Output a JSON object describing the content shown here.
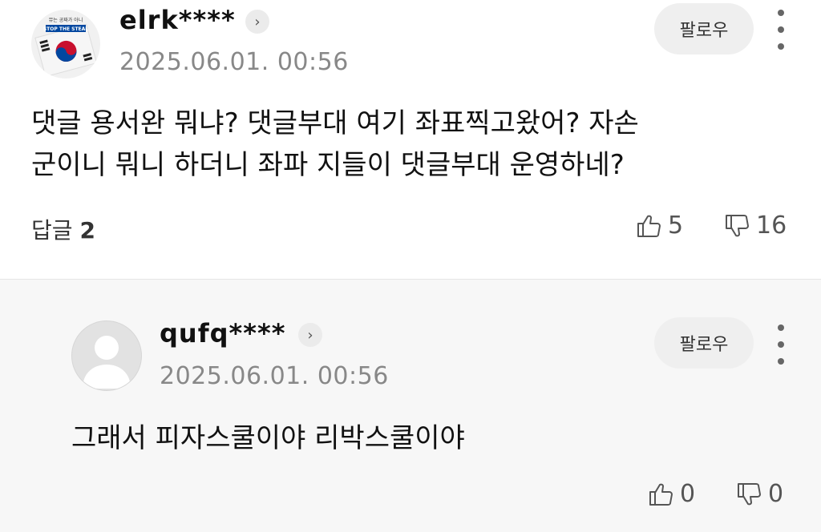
{
  "comments": [
    {
      "username": "elrk****",
      "timestamp": "2025.06.01. 00:56",
      "follow_label": "팔로우",
      "text_lines": [
        "댓글 용서완 뭐냐? 댓글부대 여기 좌표찍고왔어? 자손",
        "군이니 뭐니 하더니 좌파 지들이 댓글부대 운영하네?"
      ],
      "reply_label": "답글",
      "reply_count": "2",
      "likes": "5",
      "dislikes": "16",
      "avatar_text_top": "뮤는 공짜가 아니",
      "avatar_text_banner": "STOP THE STEAL"
    },
    {
      "username": "qufq****",
      "timestamp": "2025.06.01. 00:56",
      "follow_label": "팔로우",
      "text_lines": [
        "그래서 피자스쿨이야 리박스쿨이야"
      ],
      "likes": "0",
      "dislikes": "0"
    }
  ],
  "icons": {
    "profile_arrow": "chevron-right-icon",
    "more": "more-vertical-icon",
    "like": "thumb-up-icon",
    "dislike": "thumb-down-icon"
  },
  "colors": {
    "reply_background": "#f7f7f7",
    "follow_background": "#efefef",
    "muted_text": "#888888"
  }
}
